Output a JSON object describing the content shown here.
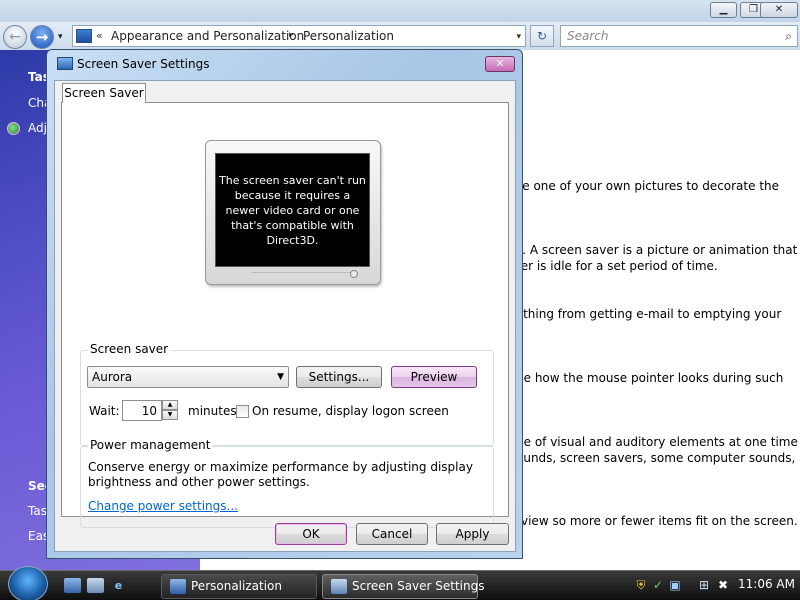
{
  "window": {
    "minimize": "▁",
    "maximize": "❐",
    "close": "✕"
  },
  "navigation": {
    "back": "←",
    "forward": "→",
    "recent": "▾",
    "breadcrumb_prefix": "«",
    "breadcrumbs": [
      "Appearance and Personalization",
      "Personalization"
    ],
    "separator": "▸",
    "dropdown": "▾",
    "refresh": "↻",
    "search_placeholder": "Search",
    "search_icon": "⌕"
  },
  "left_pane": {
    "items": [
      "Tas",
      "Cha",
      "Adj",
      "See",
      "Tas",
      "Eas"
    ]
  },
  "content": {
    "lines": [
      "se one of your own pictures to decorate the",
      "s. A screen saver is a picture or animation that",
      "ter is idle for a set period of time.",
      "ything from getting e-mail to emptying your",
      "ge how the mouse pointer looks during such",
      "ge of visual and auditory elements at one time",
      "ounds, screen savers, some computer sounds, and",
      "view so more or fewer items fit on the screen."
    ]
  },
  "dialog": {
    "title": "Screen Saver Settings",
    "close": "✕",
    "tab": "Screen Saver",
    "monitor_message": "The screen saver can't run because it requires a newer video card or one that's compatible with Direct3D.",
    "screen_saver_group": "Screen saver",
    "selected_saver": "Aurora",
    "settings_button": "Settings...",
    "preview_button": "Preview",
    "wait_label": "Wait:",
    "wait_value": "10",
    "minutes_label": "minutes",
    "resume_label": "On resume, display logon screen",
    "resume_checked": false,
    "power_group": "Power management",
    "power_description": "Conserve energy or maximize performance by adjusting display brightness and other power settings.",
    "power_link": "Change power settings...",
    "ok_button": "OK",
    "cancel_button": "Cancel",
    "apply_button": "Apply"
  },
  "taskbar": {
    "tasks": [
      "Personalization",
      "Screen Saver Settings"
    ],
    "clock": "11:06 AM"
  },
  "colors": {
    "accent_link": "#0066cc",
    "left_pane_gradient": "#5250c6",
    "hot_button": "#ecd1ef"
  }
}
